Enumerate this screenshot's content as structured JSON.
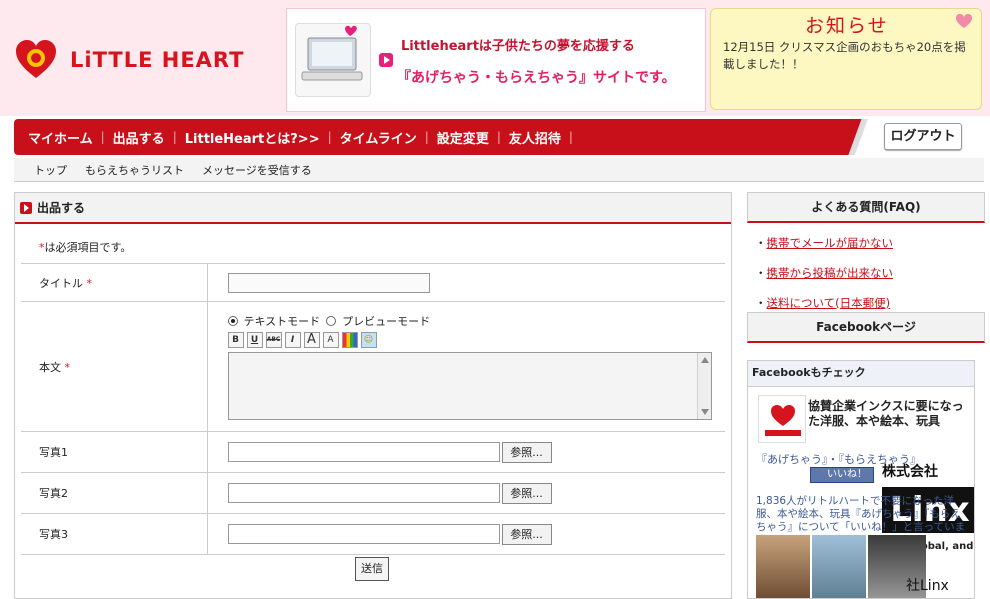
{
  "brand": {
    "logo_text": "LiTTLE HEART"
  },
  "banner": {
    "line1": "Littleheartは子供たちの夢を応援する",
    "line2": "『あげちゃう・もらえちゃう』サイトです。"
  },
  "notice": {
    "title": "お知らせ",
    "text": "12月15日 クリスマス企画のおもちゃ20点を掲載しました！！"
  },
  "nav": {
    "items": [
      "マイホーム",
      "出品する",
      "LittleHeartとは?>>",
      "タイムライン",
      "設定変更",
      "友人招待"
    ],
    "logout": "ログアウト"
  },
  "subnav": {
    "items": [
      "トップ",
      "もらえちゃうリスト",
      "メッセージを受信する"
    ]
  },
  "main": {
    "title": "出品する",
    "required_note": "は必須項目です。",
    "required_mark": "*",
    "fields": {
      "title_label": "タイトル",
      "body_label": "本文",
      "photo1_label": "写真1",
      "photo2_label": "写真2",
      "photo3_label": "写真3"
    },
    "modes": {
      "text": "テキストモード",
      "preview": "プレビューモード"
    },
    "browse_label": "参照...",
    "submit_label": "送信"
  },
  "sidebar": {
    "faq_title": "よくある質問(FAQ)",
    "faq_items": [
      "携帯でメールが届かない",
      "携帯から投稿が出来ない",
      "送料について(日本郵便)"
    ],
    "facebook_title": "Facebookページ",
    "fb_check": "Facebookもチェック",
    "fb_page_title": "協賛企業インクスに要になった洋服、本や絵本、玩具",
    "fb_text": "『あげちゃう』・『もらえちゃう』",
    "fb_like": "いいね！",
    "fb_count": "1,836人がリトルハートで不要になった洋服、本や絵本、玩具『あげちゃう』『もらえちゃう』について「いいね！」と言っています。",
    "linx_name": "株式会社",
    "linx_logo": "Linx",
    "linx_tag": "Great,Global, and Growth",
    "photo_label": "社Linx"
  }
}
